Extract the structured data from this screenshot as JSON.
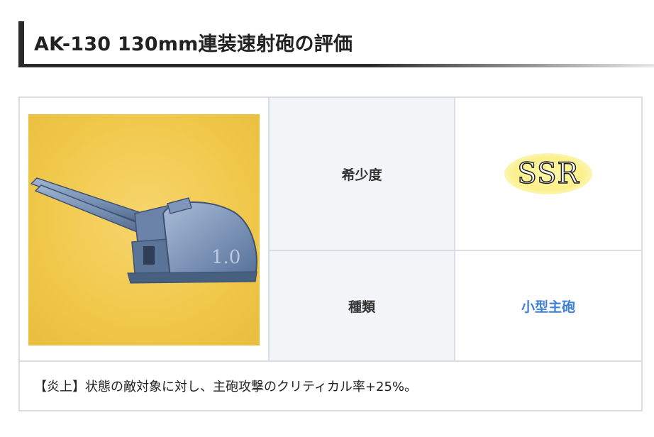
{
  "section": {
    "title": "AK-130 130mm連装速射砲の評価"
  },
  "equipment": {
    "image_alt": "AK-130 turret",
    "rarity_label": "希少度",
    "rarity_value": "SSR",
    "type_label": "種類",
    "type_value": "小型主砲",
    "description": "【炎上】状態の敵対象に対し、主砲攻撃のクリティカル率+25%。"
  },
  "colors": {
    "heading_bar": "#2b2b2b",
    "border": "#d9dde4",
    "label_bg": "#f2f4f7",
    "type_link": "#3f7fd6",
    "image_bg": "#f0c84a",
    "ssr_glow": "#fbf08a"
  }
}
